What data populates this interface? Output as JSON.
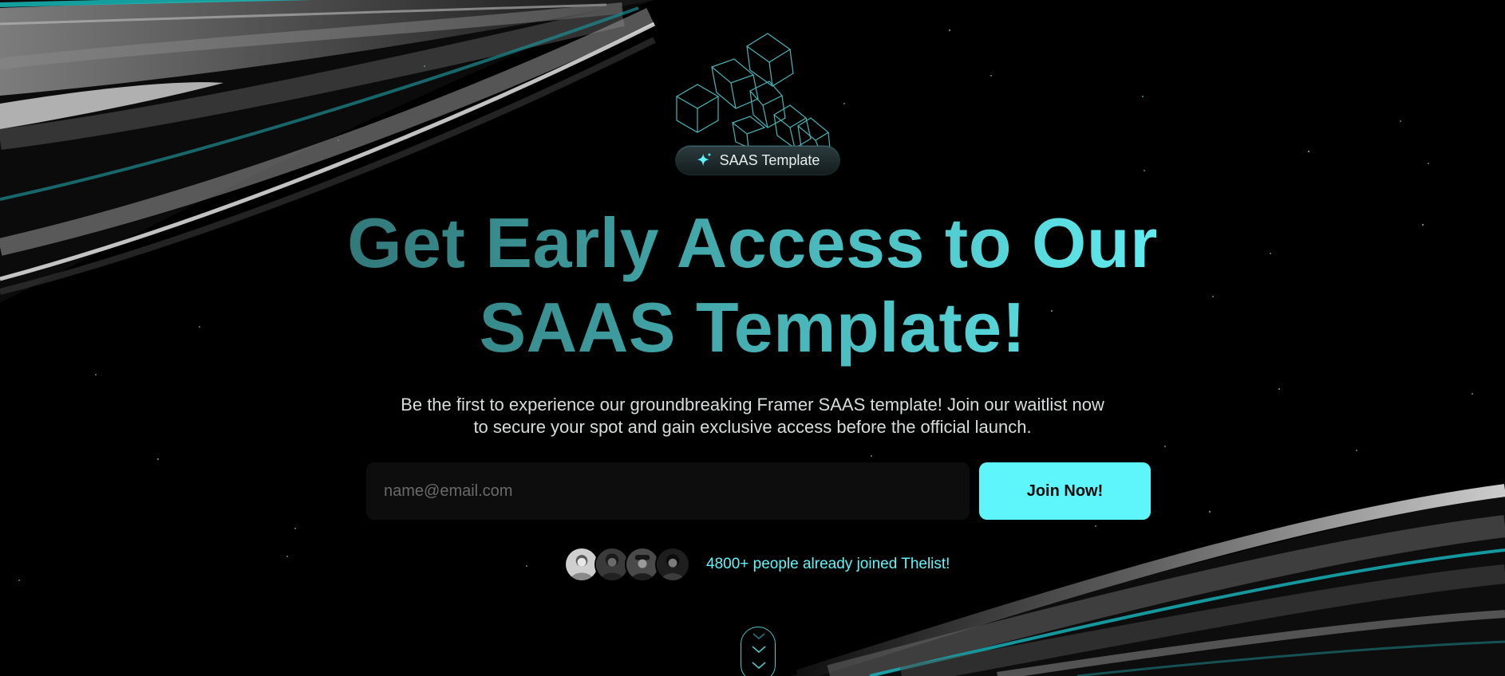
{
  "hero": {
    "badge_icon": "sparkle-icon",
    "badge_label": "SAAS Template",
    "headline_line1": "Get Early Access to Our",
    "headline_line2": "SAAS Template!",
    "subtitle_line1": "Be the first to experience our groundbreaking Framer SAAS template! Join our waitlist now",
    "subtitle_line2": "to secure your spot and gain exclusive access before the official launch."
  },
  "waitlist_form": {
    "email_placeholder": "name@email.com",
    "email_value": "",
    "submit_label": "Join Now!"
  },
  "social_proof": {
    "avatar_count": 4,
    "text": "4800+ people already joined Thelist!"
  },
  "scroll_indicator": {
    "icon": "chevron-double-down-icon"
  },
  "colors": {
    "background": "#000000",
    "accent": "#5ff6fb",
    "headline_gradient_start": "#2f6f70",
    "headline_gradient_end": "#65f7fb",
    "input_background": "#0d0d0d",
    "subtitle_text": "#d8dcdc"
  }
}
